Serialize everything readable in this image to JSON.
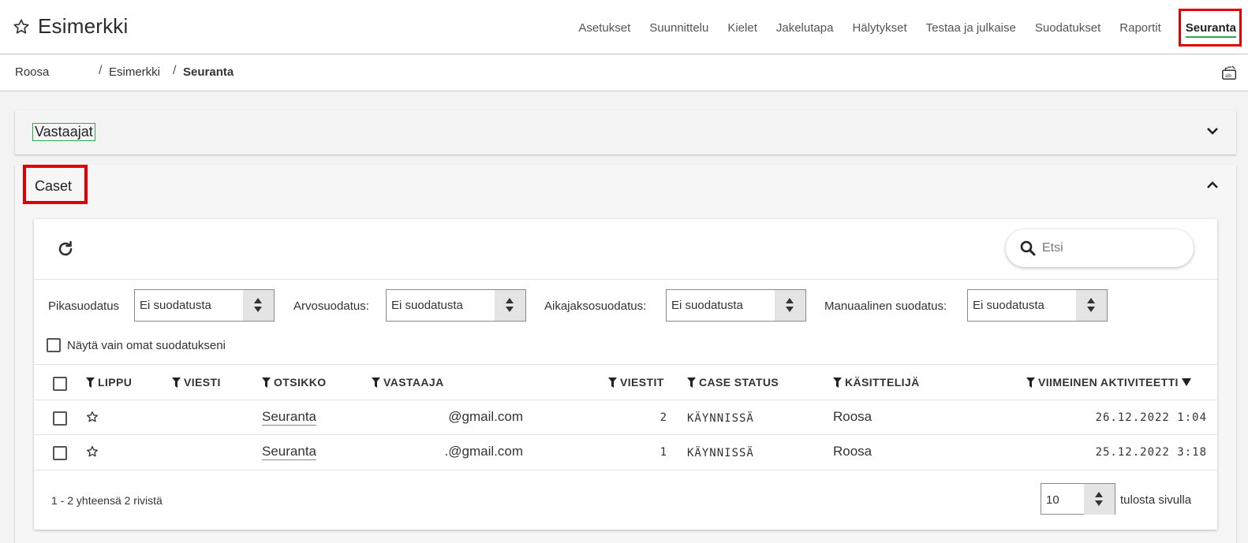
{
  "header": {
    "title": "Esimerkki",
    "nav": [
      {
        "label": "Asetukset"
      },
      {
        "label": "Suunnittelu"
      },
      {
        "label": "Kielet"
      },
      {
        "label": "Jakelutapa"
      },
      {
        "label": "Hälytykset"
      },
      {
        "label": "Testaa ja julkaise"
      },
      {
        "label": "Suodatukset"
      },
      {
        "label": "Raportit"
      },
      {
        "label": "Seuranta"
      }
    ],
    "active_nav": "Seuranta",
    "accent_color": "#2aa84a",
    "highlight_color": "#e00000"
  },
  "breadcrumb": {
    "items": [
      "Roosa",
      "Esimerkki",
      "Seuranta"
    ],
    "separator": "/"
  },
  "panels": {
    "vastaajat": {
      "title": "Vastaajat",
      "state": "collapsed"
    },
    "caset": {
      "title": "Caset",
      "state": "expanded"
    }
  },
  "search": {
    "placeholder": "Etsi",
    "value": ""
  },
  "filters": [
    {
      "label": "Pikasuodatus",
      "value": "Ei suodatusta"
    },
    {
      "label": "Arvosuodatus:",
      "value": "Ei suodatusta"
    },
    {
      "label": "Aikajaksosuodatus:",
      "value": "Ei suodatusta"
    },
    {
      "label": "Manuaalinen suodatus:",
      "value": "Ei suodatusta"
    }
  ],
  "own_filters_label": "Näytä vain omat suodatukseni",
  "table": {
    "columns": [
      "LIPPU",
      "VIESTI",
      "OTSIKKO",
      "VASTAAJA",
      "VIESTIT",
      "CASE STATUS",
      "KÄSITTELIJÄ",
      "VIIMEINEN AKTIVITEETTI"
    ],
    "rows": [
      {
        "otsikko": "Seuranta",
        "vastaaja": "@gmail.com",
        "viestit": "2",
        "status": "KÄYNNISSÄ",
        "kasittelija": "Roosa",
        "aktiviteetti": "26.12.2022 1:04"
      },
      {
        "otsikko": "Seuranta",
        "vastaaja": ".@gmail.com",
        "viestit": "1",
        "status": "KÄYNNISSÄ",
        "kasittelija": "Roosa",
        "aktiviteetti": "25.12.2022 3:18"
      }
    ]
  },
  "footer": {
    "summary": "1 - 2 yhteensä 2 rivistä",
    "page_size": "10",
    "page_size_label": "tulosta sivulla"
  }
}
